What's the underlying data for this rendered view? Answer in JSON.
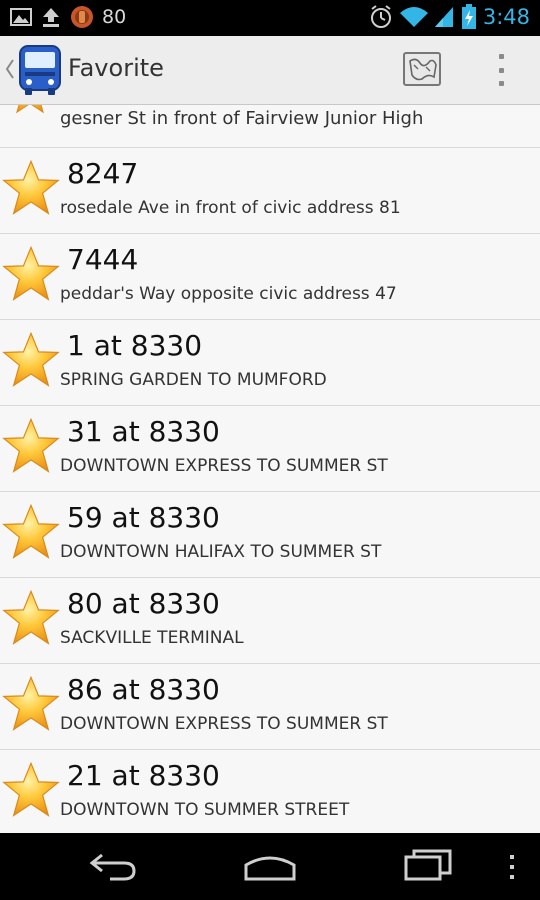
{
  "status_bar": {
    "notification_count": "80",
    "time": "3:48",
    "time_color": "#33b5e5",
    "icons": [
      "image-icon",
      "upload-icon",
      "app-notification-icon",
      "alarm-icon",
      "wifi-icon",
      "signal-icon",
      "battery-charging-icon"
    ]
  },
  "action_bar": {
    "title": "Favorite",
    "icons": [
      "up-caret-icon",
      "bus-app-icon",
      "map-icon",
      "overflow-menu-icon"
    ]
  },
  "favorites": {
    "partial_item": {
      "subtitle": "gesner St in front of Fairview Junior High"
    },
    "items": [
      {
        "title": "8247",
        "subtitle": "rosedale Ave in front of civic address 81"
      },
      {
        "title": "7444",
        "subtitle": "peddar's Way opposite civic address 47"
      },
      {
        "title": "1 at 8330",
        "subtitle": "SPRING GARDEN TO MUMFORD"
      },
      {
        "title": "31 at 8330",
        "subtitle": "DOWNTOWN EXPRESS TO SUMMER ST"
      },
      {
        "title": "59 at 8330",
        "subtitle": "DOWNTOWN HALIFAX TO SUMMER ST"
      },
      {
        "title": "80 at 8330",
        "subtitle": "SACKVILLE TERMINAL"
      },
      {
        "title": "86 at 8330",
        "subtitle": "DOWNTOWN EXPRESS TO SUMMER ST"
      },
      {
        "title": "21 at 8330",
        "subtitle": "DOWNTOWN TO SUMMER STREET"
      }
    ],
    "star_color": "#f5a623"
  },
  "nav_bar": {
    "icons": [
      "back-icon",
      "home-icon",
      "recents-icon",
      "menu-icon"
    ]
  }
}
